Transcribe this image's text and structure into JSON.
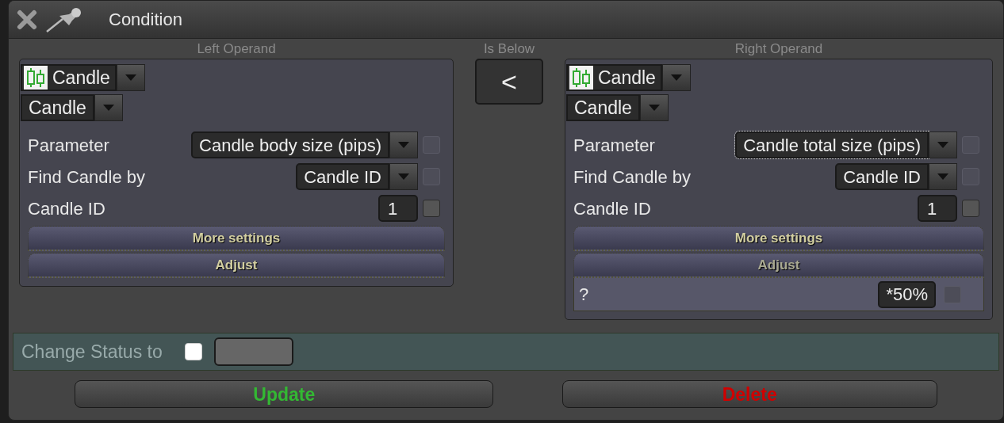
{
  "window": {
    "title": "Condition"
  },
  "operands": [
    {
      "heading": "Left Operand",
      "source": "Candle",
      "subtype": "Candle",
      "params": [
        {
          "kind": "dropdown",
          "label": "Parameter",
          "value": "Candle body size (pips)",
          "focused": false,
          "check_enabled": false
        },
        {
          "kind": "dropdown",
          "label": "Find Candle by",
          "value": "Candle ID",
          "focused": false,
          "check_enabled": false
        },
        {
          "kind": "number",
          "label": "Candle ID",
          "value": "1",
          "focused": false,
          "check_enabled": true
        }
      ],
      "sections": [
        {
          "label": "More settings",
          "expanded": false
        },
        {
          "label": "Adjust",
          "expanded": false
        }
      ]
    },
    {
      "heading": "Right Operand",
      "source": "Candle",
      "subtype": "Candle",
      "params": [
        {
          "kind": "dropdown",
          "label": "Parameter",
          "value": "Candle total size (pips)",
          "focused": true,
          "check_enabled": false
        },
        {
          "kind": "dropdown",
          "label": "Find Candle by",
          "value": "Candle ID",
          "focused": false,
          "check_enabled": false
        },
        {
          "kind": "number",
          "label": "Candle ID",
          "value": "1",
          "focused": false,
          "check_enabled": true
        }
      ],
      "sections": [
        {
          "label": "More settings",
          "expanded": false
        },
        {
          "label": "Adjust",
          "expanded": true,
          "rows": [
            {
              "label": "?",
              "value": "*50%",
              "check_enabled": false
            }
          ]
        }
      ]
    }
  ],
  "operator": {
    "label": "Is Below",
    "symbol": "<"
  },
  "status": {
    "label": "Change Status to",
    "checked": false
  },
  "buttons": [
    {
      "kind": "update",
      "label": "Update"
    },
    {
      "kind": "delete",
      "label": "Delete"
    }
  ]
}
